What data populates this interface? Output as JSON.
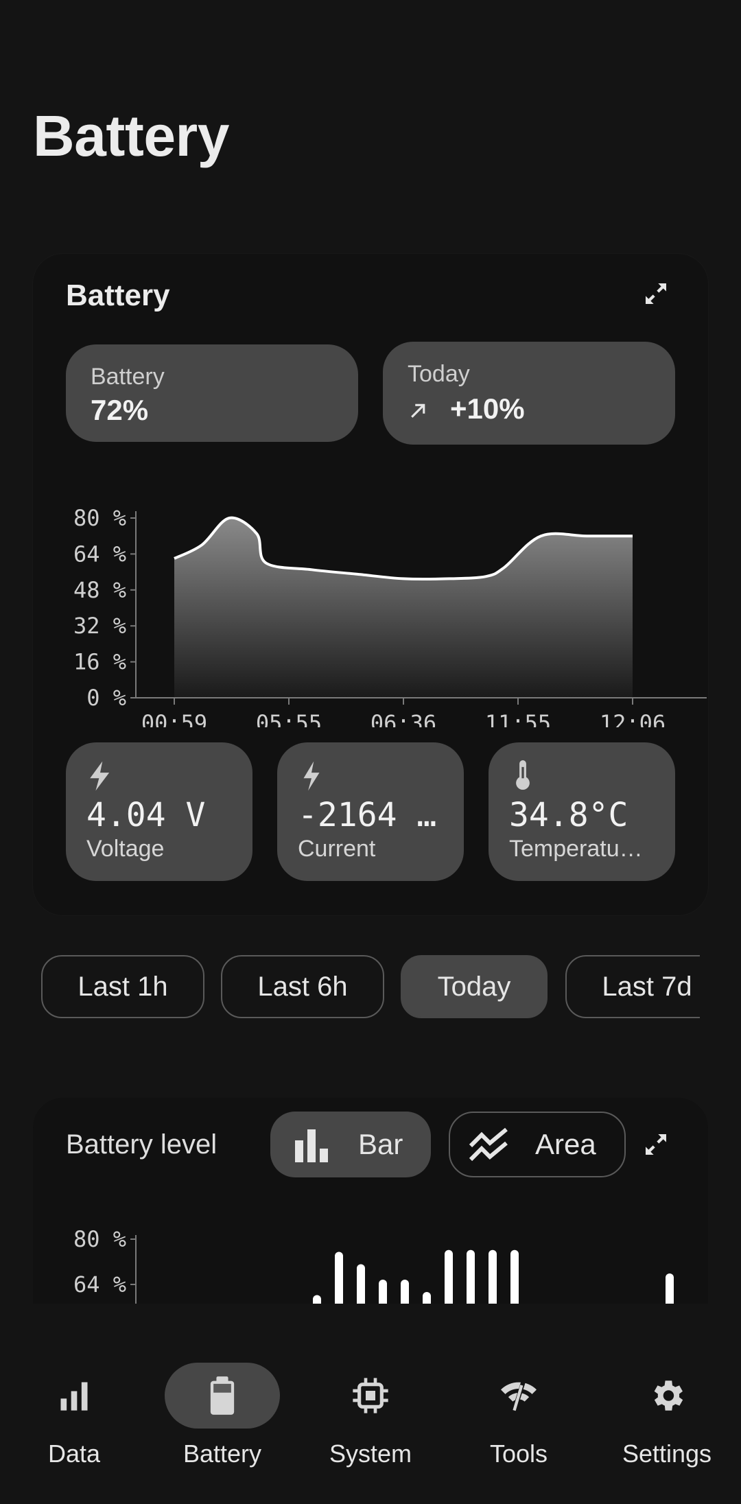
{
  "page": {
    "title": "Battery"
  },
  "battery_card": {
    "title": "Battery",
    "level_pill": {
      "label": "Battery",
      "value": "72%"
    },
    "today_pill": {
      "label": "Today",
      "value": "+10%"
    },
    "stats": [
      {
        "icon": "bolt-icon",
        "value": "4.04 V",
        "label": "Voltage"
      },
      {
        "icon": "bolt-icon",
        "value": "-2164 …",
        "label": "Current"
      },
      {
        "icon": "thermometer-icon",
        "value": "34.8°C",
        "label": "Temperatu…"
      }
    ]
  },
  "chart_data": [
    {
      "type": "area",
      "y_unit": "%",
      "ylim": [
        0,
        80
      ],
      "y_ticks": [
        "80 %",
        "64 %",
        "48 %",
        "32 %",
        "16 %",
        "0 %"
      ],
      "x_ticks": [
        "00:59",
        "05:55",
        "06:36",
        "11:55",
        "12:06"
      ],
      "series": [
        {
          "points": [
            [
              0,
              62
            ],
            [
              0.3,
              68
            ],
            [
              0.6,
              80
            ],
            [
              0.9,
              73
            ],
            [
              1.0,
              60
            ],
            [
              1.5,
              57
            ],
            [
              2.0,
              55
            ],
            [
              2.5,
              53
            ],
            [
              3.0,
              53
            ],
            [
              3.4,
              54
            ],
            [
              3.6,
              58
            ],
            [
              4.0,
              72
            ],
            [
              4.5,
              72
            ],
            [
              5.0,
              72
            ]
          ]
        }
      ],
      "line_color": "#ffffff"
    },
    {
      "type": "bar",
      "y_unit": "%",
      "y_ticks": [
        "80 %",
        "64 %"
      ],
      "values_visible_top": [
        0.25,
        0.95,
        0.75,
        0.5,
        0.5,
        0.3,
        0.98,
        0.98,
        0.98,
        0.98,
        0.05,
        0.6
      ]
    }
  ],
  "time_ranges": [
    "Last 1h",
    "Last 6h",
    "Today",
    "Last 7d"
  ],
  "time_range_selected": "Today",
  "level_card": {
    "title": "Battery level",
    "bar_label": "Bar",
    "area_label": "Area",
    "selected": "Bar"
  },
  "nav": [
    {
      "label": "Data",
      "icon": "bar-chart-icon"
    },
    {
      "label": "Battery",
      "icon": "battery-icon"
    },
    {
      "label": "System",
      "icon": "chip-icon"
    },
    {
      "label": "Tools",
      "icon": "tools-icon"
    },
    {
      "label": "Settings",
      "icon": "gear-icon"
    }
  ],
  "nav_selected": "Battery"
}
